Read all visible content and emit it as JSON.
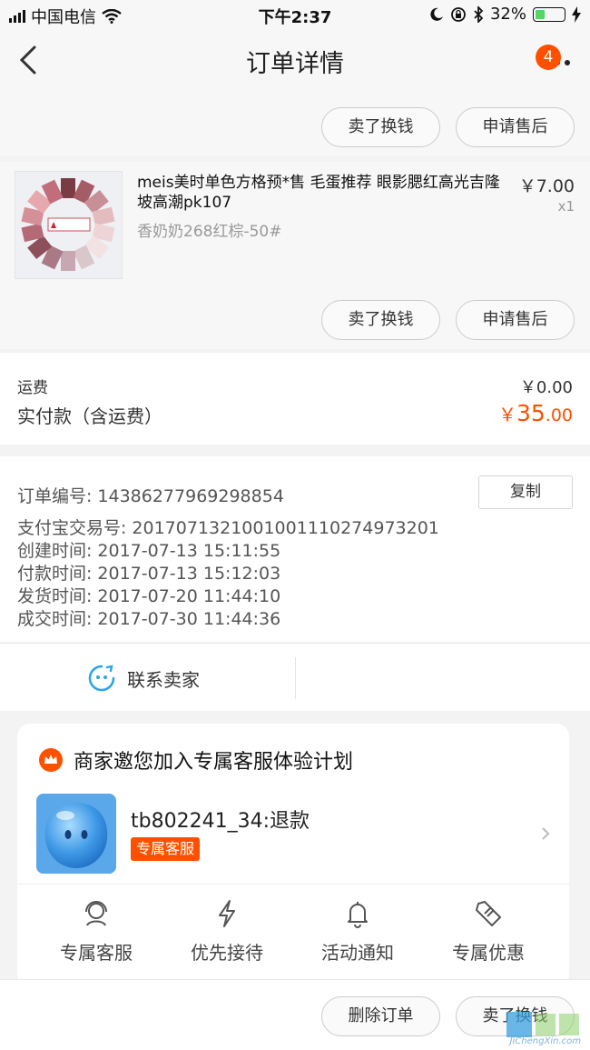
{
  "status_bar": {
    "carrier": "中国电信",
    "time": "下午2:37",
    "battery": "32%",
    "battery_level": 0.32
  },
  "nav": {
    "title": "订单详情",
    "badge": "4"
  },
  "top_actions": {
    "sell": "卖了换钱",
    "after_sale": "申请售后"
  },
  "product": {
    "name": "meis美时单色方格预*售 毛蛋推荐 眼影腮红高光吉隆坡高潮pk107",
    "sku": "香奶奶268红棕-50#",
    "price": "￥7.00",
    "qty": "x1",
    "sell": "卖了换钱",
    "after_sale": "申请售后"
  },
  "fees": {
    "shipping_label": "运费",
    "shipping_value": "￥0.00",
    "paid_label": "实付款（含运费）",
    "paid_currency": "￥",
    "paid_int": "35",
    "paid_dec": ".00"
  },
  "order_info": {
    "order_no_label": "订单编号:",
    "order_no": "14386277969298854",
    "copy": "复制",
    "alipay_label": "支付宝交易号:",
    "alipay_no": "2017071321001001110274973201",
    "created_label": "创建时间:",
    "created": "2017-07-13 15:11:55",
    "paid_label": "付款时间:",
    "paid": "2017-07-13 15:12:03",
    "shipped_label": "发货时间:",
    "shipped": "2017-07-20 11:44:10",
    "done_label": "成交时间:",
    "done": "2017-07-30 11:44:36"
  },
  "contact": {
    "label": "联系卖家"
  },
  "service_card": {
    "title": "商家邀您加入专属客服体验计划",
    "username": "tb802241_34:退款",
    "tag": "专属客服",
    "features": [
      "专属客服",
      "优先接待",
      "活动通知",
      "专属优惠"
    ]
  },
  "bottom_bar": {
    "delete": "删除订单",
    "sell": "卖了换钱"
  },
  "watermark": {
    "text": "JiChengXin.com"
  },
  "colors": {
    "accent": "#ff5000",
    "battery": "#4cd964",
    "contact_icon": "#2aa6e8"
  }
}
